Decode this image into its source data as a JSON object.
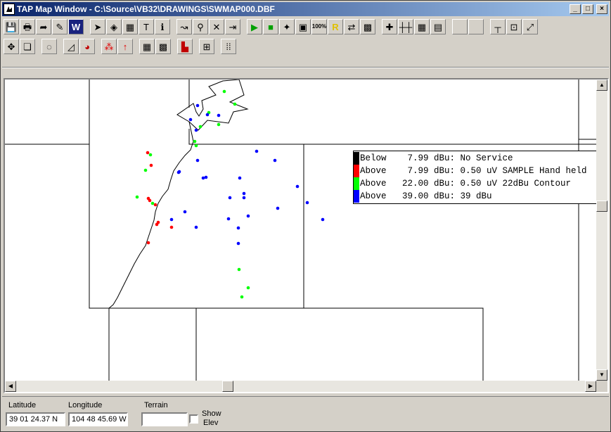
{
  "window": {
    "title": "TAP Map Window - C:\\Source\\VB32\\DRAWINGS\\SWMAP000.DBF",
    "buttons": [
      "_",
      "□",
      "×"
    ]
  },
  "toolbar": {
    "row1": [
      {
        "name": "save-icon",
        "glyph": "💾"
      },
      {
        "name": "print-icon",
        "glyph": "🖶"
      },
      {
        "name": "export-icon",
        "glyph": "➦"
      },
      {
        "name": "edit-icon",
        "glyph": "✎"
      },
      {
        "name": "w-icon",
        "glyph": "W"
      },
      {
        "name": "pointer-icon",
        "glyph": "➤"
      },
      {
        "name": "fill-icon",
        "glyph": "◈"
      },
      {
        "name": "layers-icon",
        "glyph": "▦"
      },
      {
        "name": "text-icon",
        "glyph": "T"
      },
      {
        "name": "info-icon",
        "glyph": "ℹ"
      },
      {
        "name": "route-icon",
        "glyph": "↝"
      },
      {
        "name": "search-icon",
        "glyph": "⚲"
      },
      {
        "name": "delete-icon",
        "glyph": "✕"
      },
      {
        "name": "exit-icon",
        "glyph": "⇥"
      },
      {
        "name": "green-1-icon",
        "glyph": "▶"
      },
      {
        "name": "green-2-icon",
        "glyph": "■"
      },
      {
        "name": "pin-icon",
        "glyph": "✦"
      },
      {
        "name": "red-green-icon",
        "glyph": "▣"
      },
      {
        "name": "zoom-100-icon",
        "glyph": "100%"
      },
      {
        "name": "r-icon",
        "glyph": "R"
      },
      {
        "name": "swap-icon",
        "glyph": "⇄"
      },
      {
        "name": "map-icon",
        "glyph": "▩"
      },
      {
        "name": "crosshair-icon",
        "glyph": "✚"
      },
      {
        "name": "ruler-icon",
        "glyph": "┼┼"
      },
      {
        "name": "grid-icon",
        "glyph": "▦"
      },
      {
        "name": "notes-icon",
        "glyph": "▤"
      },
      {
        "name": "blank-1-icon",
        "glyph": ""
      },
      {
        "name": "blank-2-icon",
        "glyph": ""
      },
      {
        "name": "axis-icon",
        "glyph": "┬"
      },
      {
        "name": "zoom-box-icon",
        "glyph": "⊡"
      },
      {
        "name": "expand-icon",
        "glyph": "⤢"
      }
    ],
    "row2": [
      {
        "name": "pan-icon",
        "glyph": "✥"
      },
      {
        "name": "overlay-icon",
        "glyph": "❏"
      },
      {
        "name": "shape-icon",
        "glyph": "◌"
      },
      {
        "name": "profile-icon",
        "glyph": "◿"
      },
      {
        "name": "pie-icon",
        "glyph": "◕"
      },
      {
        "name": "points-icon",
        "glyph": "⁂"
      },
      {
        "name": "arrow-up-icon",
        "glyph": "↑"
      },
      {
        "name": "grid-2-icon",
        "glyph": "▦"
      },
      {
        "name": "color-grid-icon",
        "glyph": "▩"
      },
      {
        "name": "histogram-icon",
        "glyph": "▙"
      },
      {
        "name": "network-icon",
        "glyph": "⊞"
      },
      {
        "name": "dots-grid-icon",
        "glyph": "⁞⁞"
      }
    ]
  },
  "legend": {
    "rows": [
      {
        "color": "#000000",
        "text": "Below    7.99 dBu: No Service"
      },
      {
        "color": "#ff0000",
        "text": "Above    7.99 dBu: 0.50 uV SAMPLE Hand held"
      },
      {
        "color": "#00ff00",
        "text": "Above   22.00 dBu: 0.50 uV 22dBu Contour"
      },
      {
        "color": "#0000ff",
        "text": "Above   39.00 dBu: 39 dBu"
      }
    ]
  },
  "map": {
    "point_colors": {
      "red": "#ff0000",
      "green": "#00ff00",
      "blue": "#0000ff"
    }
  },
  "status": {
    "latitude_label": "Latitude",
    "latitude_value": "39 01 24.37 N",
    "longitude_label": "Longitude",
    "longitude_value": "104 48 45.69 W",
    "terrain_label": "Terrain",
    "terrain_value": "",
    "show_elev_label_1": "Show",
    "show_elev_label_2": "Elev",
    "show_elev_checked": false
  }
}
